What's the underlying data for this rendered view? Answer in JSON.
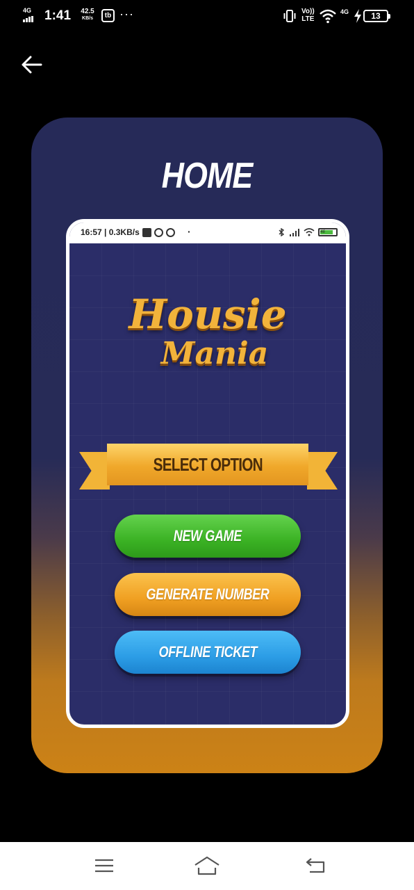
{
  "status_bar": {
    "network_type": "4G",
    "time": "1:41",
    "speed_value": "42.5",
    "speed_unit": "KB/s",
    "app_badge": "tb",
    "more": "···",
    "volte_top": "Vo))",
    "volte_bottom": "LTE",
    "network_type_2": "4G",
    "battery": "13"
  },
  "header": {
    "back_icon": "arrow-left-icon"
  },
  "card": {
    "title": "HOME",
    "colors": {
      "top": "#262a58",
      "bottom": "#cc8216"
    }
  },
  "inner_phone": {
    "status": {
      "time_speed": "16:57 | 0.3KB/s",
      "dot": "·",
      "battery": "46"
    },
    "logo_line1": "Housie",
    "logo_line2": "Mania",
    "ribbon_label": "SELECT OPTION",
    "buttons": [
      {
        "label": "NEW GAME",
        "color": "#3bb224"
      },
      {
        "label": "GENERATE NUMBER",
        "color": "#f0a022"
      },
      {
        "label": "OFFLINE TICKET",
        "color": "#2c9de6"
      }
    ]
  },
  "nav_bar": {
    "menu_icon": "menu-icon",
    "home_icon": "home-icon",
    "back_icon": "back-icon"
  }
}
